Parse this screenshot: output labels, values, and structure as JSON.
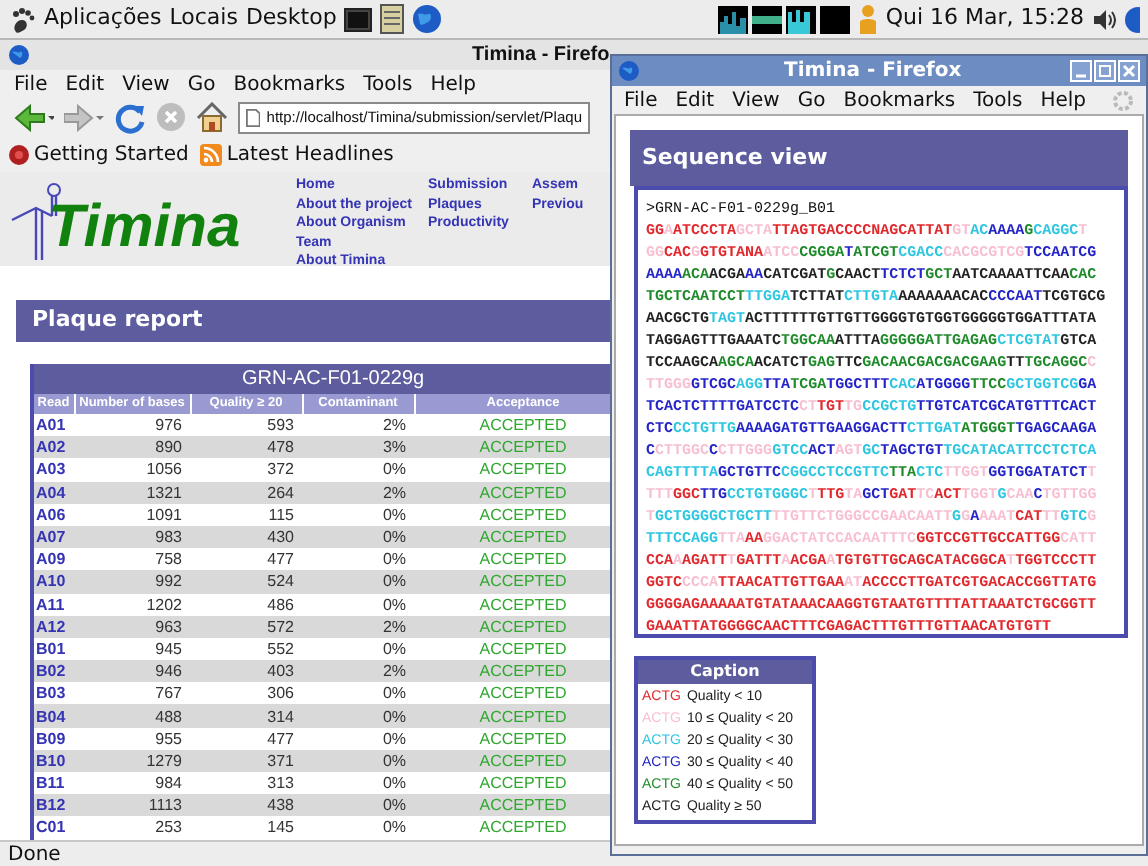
{
  "panel": {
    "menus": [
      "Aplicações",
      "Locais",
      "Desktop"
    ],
    "clock": "Qui 16 Mar, 15:28"
  },
  "back_window": {
    "title": "Timina - Firefo",
    "menu": [
      "File",
      "Edit",
      "View",
      "Go",
      "Bookmarks",
      "Tools",
      "Help"
    ],
    "address": "http://localhost/Timina/submission/servlet/Plaqu",
    "bookmarks": [
      "Getting Started",
      "Latest Headlines"
    ],
    "logo": "Timina",
    "nav_columns": [
      [
        "Home",
        "About the project",
        "About Organism",
        "Team",
        "About Timina"
      ],
      [
        "Submission",
        "Plaques",
        "Productivity"
      ],
      [
        "Assem",
        "Previou"
      ]
    ],
    "section_title": "Plaque report",
    "table": {
      "title": "GRN-AC-F01-0229g",
      "columns": [
        "Read",
        "Number of bases",
        "Quality ≥ 20",
        "Contaminant",
        "Acceptance"
      ],
      "rows": [
        [
          "A01",
          "976",
          "593",
          "2%",
          "ACCEPTED"
        ],
        [
          "A02",
          "890",
          "478",
          "3%",
          "ACCEPTED"
        ],
        [
          "A03",
          "1056",
          "372",
          "0%",
          "ACCEPTED"
        ],
        [
          "A04",
          "1321",
          "264",
          "2%",
          "ACCEPTED"
        ],
        [
          "A06",
          "1091",
          "115",
          "0%",
          "ACCEPTED"
        ],
        [
          "A07",
          "983",
          "430",
          "0%",
          "ACCEPTED"
        ],
        [
          "A09",
          "758",
          "477",
          "0%",
          "ACCEPTED"
        ],
        [
          "A10",
          "992",
          "524",
          "0%",
          "ACCEPTED"
        ],
        [
          "A11",
          "1202",
          "486",
          "0%",
          "ACCEPTED"
        ],
        [
          "A12",
          "963",
          "572",
          "2%",
          "ACCEPTED"
        ],
        [
          "B01",
          "945",
          "552",
          "0%",
          "ACCEPTED"
        ],
        [
          "B02",
          "946",
          "403",
          "2%",
          "ACCEPTED"
        ],
        [
          "B03",
          "767",
          "306",
          "0%",
          "ACCEPTED"
        ],
        [
          "B04",
          "488",
          "314",
          "0%",
          "ACCEPTED"
        ],
        [
          "B09",
          "955",
          "477",
          "0%",
          "ACCEPTED"
        ],
        [
          "B10",
          "1279",
          "371",
          "0%",
          "ACCEPTED"
        ],
        [
          "B11",
          "984",
          "313",
          "0%",
          "ACCEPTED"
        ],
        [
          "B12",
          "1113",
          "438",
          "0%",
          "ACCEPTED"
        ],
        [
          "C01",
          "253",
          "145",
          "0%",
          "ACCEPTED"
        ]
      ]
    },
    "status": "Done"
  },
  "popup": {
    "title": "Timina - Firefox",
    "menu": [
      "File",
      "Edit",
      "View",
      "Go",
      "Bookmarks",
      "Tools",
      "Help"
    ],
    "section_title": "Sequence view",
    "sequence": {
      "header": ">GRN-AC-F01-0229g_B01",
      "lines": [
        [
          {
            "text": "GG",
            "color": "#e0282d"
          },
          {
            "text": "A",
            "color": "#f7bfd0"
          },
          {
            "text": "ATCCCTA",
            "color": "#e0282d"
          },
          {
            "text": "GCTA",
            "color": "#f7bfd0"
          },
          {
            "text": "TTAGTGACCCCNAGCATTAT",
            "color": "#e0282d"
          },
          {
            "text": "GT",
            "color": "#f7bfd0"
          },
          {
            "text": "AC",
            "color": "#2ec6e0"
          },
          {
            "text": "AAAA",
            "color": "#2424c8"
          },
          {
            "text": "G",
            "color": "#1e8a2a"
          },
          {
            "text": "CAGGC",
            "color": "#2ec6e0"
          },
          {
            "text": "T",
            "color": "#f7bfd0"
          }
        ],
        [
          {
            "text": "GG",
            "color": "#f7bfd0"
          },
          {
            "text": "CAC",
            "color": "#e0282d"
          },
          {
            "text": "G",
            "color": "#f7bfd0"
          },
          {
            "text": "GTGTANA",
            "color": "#e0282d"
          },
          {
            "text": "ATCC",
            "color": "#f7bfd0"
          },
          {
            "text": "CGGGA",
            "color": "#1e8a2a"
          },
          {
            "text": "T",
            "color": "#2424c8"
          },
          {
            "text": "ATCGT",
            "color": "#1e8a2a"
          },
          {
            "text": "CGACC",
            "color": "#2ec6e0"
          },
          {
            "text": "CACGCGTCG",
            "color": "#f7bfd0"
          },
          {
            "text": "TCCAATCG",
            "color": "#2424c8"
          }
        ],
        [
          {
            "text": "AAAA",
            "color": "#2424c8"
          },
          {
            "text": "ACA",
            "color": "#1e8a2a"
          },
          {
            "text": "ACGA",
            "color": "#222222"
          },
          {
            "text": "AA",
            "color": "#2424c8"
          },
          {
            "text": "CATCGAT",
            "color": "#222222"
          },
          {
            "text": "G",
            "color": "#1e8a2a"
          },
          {
            "text": "CAACT",
            "color": "#222222"
          },
          {
            "text": "TCTCT",
            "color": "#2424c8"
          },
          {
            "text": "GCT",
            "color": "#1e8a2a"
          },
          {
            "text": "AATCAAAATTCAA",
            "color": "#222222"
          },
          {
            "text": "CAC",
            "color": "#1e8a2a"
          }
        ],
        [
          {
            "text": "TGCTCAATCCT",
            "color": "#1e8a2a"
          },
          {
            "text": "TTGGA",
            "color": "#2ec6e0"
          },
          {
            "text": "TCTTAT",
            "color": "#222222"
          },
          {
            "text": "CTTGTA",
            "color": "#2ec6e0"
          },
          {
            "text": "AAAAAAACAC",
            "color": "#222222"
          },
          {
            "text": "CCCAAT",
            "color": "#2424c8"
          },
          {
            "text": "TCGTGCG",
            "color": "#222222"
          }
        ],
        [
          {
            "text": "AACGCTG",
            "color": "#222222"
          },
          {
            "text": "TAGT",
            "color": "#2ec6e0"
          },
          {
            "text": "ACTTTTTTGTTGTTGGGGTGTGGTGGGGGTGGATTTATA",
            "color": "#222222"
          }
        ],
        [
          {
            "text": "TAGGAGTTTGAAATC",
            "color": "#222222"
          },
          {
            "text": "TGGCAA",
            "color": "#1e8a2a"
          },
          {
            "text": "ATTTA",
            "color": "#222222"
          },
          {
            "text": "GGGGGATTGAGAG",
            "color": "#1e8a2a"
          },
          {
            "text": "CTCGTAT",
            "color": "#2ec6e0"
          },
          {
            "text": "GTCA",
            "color": "#222222"
          }
        ],
        [
          {
            "text": "TCCAAGCA",
            "color": "#222222"
          },
          {
            "text": "AGCA",
            "color": "#1e8a2a"
          },
          {
            "text": "ACATCT",
            "color": "#222222"
          },
          {
            "text": "GAG",
            "color": "#1e8a2a"
          },
          {
            "text": "TTC",
            "color": "#222222"
          },
          {
            "text": "GACAACGACGACGAAG",
            "color": "#1e8a2a"
          },
          {
            "text": "TT",
            "color": "#222222"
          },
          {
            "text": "TGCAGGC",
            "color": "#1e8a2a"
          },
          {
            "text": "C",
            "color": "#f7bfd0"
          }
        ],
        [
          {
            "text": "TTGGG",
            "color": "#f7bfd0"
          },
          {
            "text": "GTCGC",
            "color": "#2424c8"
          },
          {
            "text": "AGG",
            "color": "#2ec6e0"
          },
          {
            "text": "TTA",
            "color": "#2424c8"
          },
          {
            "text": "TCGA",
            "color": "#1e8a2a"
          },
          {
            "text": "TGGCTTT",
            "color": "#2424c8"
          },
          {
            "text": "CAC",
            "color": "#2ec6e0"
          },
          {
            "text": "ATGGGG",
            "color": "#2424c8"
          },
          {
            "text": "TTCC",
            "color": "#1e8a2a"
          },
          {
            "text": "GCTGGTCG",
            "color": "#2ec6e0"
          },
          {
            "text": "GA",
            "color": "#2424c8"
          }
        ],
        [
          {
            "text": "TCACTCTTTTGATCCTC",
            "color": "#2424c8"
          },
          {
            "text": "CT",
            "color": "#f7bfd0"
          },
          {
            "text": "TGT",
            "color": "#e0282d"
          },
          {
            "text": "TG",
            "color": "#f7bfd0"
          },
          {
            "text": "CCGCTG",
            "color": "#2ec6e0"
          },
          {
            "text": "TTGTCATCGCATGTTTCACT",
            "color": "#2424c8"
          }
        ],
        [
          {
            "text": "CTC",
            "color": "#2424c8"
          },
          {
            "text": "CCTGTTG",
            "color": "#2ec6e0"
          },
          {
            "text": "AAAAGATGTTGAAGGACTT",
            "color": "#2424c8"
          },
          {
            "text": "CTTGAT",
            "color": "#2ec6e0"
          },
          {
            "text": "ATGGGT",
            "color": "#1e8a2a"
          },
          {
            "text": "TGAGCAAGA",
            "color": "#2424c8"
          }
        ],
        [
          {
            "text": "C",
            "color": "#2424c8"
          },
          {
            "text": "CTTGGC",
            "color": "#f7bfd0"
          },
          {
            "text": "C",
            "color": "#2424c8"
          },
          {
            "text": "CTTGGG",
            "color": "#f7bfd0"
          },
          {
            "text": "GTCC",
            "color": "#2ec6e0"
          },
          {
            "text": "ACT",
            "color": "#2424c8"
          },
          {
            "text": "AGT",
            "color": "#f7bfd0"
          },
          {
            "text": "GC",
            "color": "#2ec6e0"
          },
          {
            "text": "TAGCTGT",
            "color": "#2424c8"
          },
          {
            "text": "TGCATACATTCCTCTCA",
            "color": "#2ec6e0"
          }
        ],
        [
          {
            "text": "CAGTTTTA",
            "color": "#2ec6e0"
          },
          {
            "text": "GCTGTTC",
            "color": "#2424c8"
          },
          {
            "text": "CGGCCTCCGTTC",
            "color": "#2ec6e0"
          },
          {
            "text": "TTA",
            "color": "#1e8a2a"
          },
          {
            "text": "CTC",
            "color": "#2ec6e0"
          },
          {
            "text": "TTGGT",
            "color": "#f7bfd0"
          },
          {
            "text": "GGTGGATATCT",
            "color": "#2424c8"
          },
          {
            "text": "T",
            "color": "#f7bfd0"
          }
        ],
        [
          {
            "text": "TTT",
            "color": "#f7bfd0"
          },
          {
            "text": "GGC",
            "color": "#e0282d"
          },
          {
            "text": "TTG",
            "color": "#2424c8"
          },
          {
            "text": "CCTGTGGGC",
            "color": "#2ec6e0"
          },
          {
            "text": "T",
            "color": "#f7bfd0"
          },
          {
            "text": "TTG",
            "color": "#e0282d"
          },
          {
            "text": "TA",
            "color": "#f7bfd0"
          },
          {
            "text": "GCT",
            "color": "#2424c8"
          },
          {
            "text": "GAT",
            "color": "#e0282d"
          },
          {
            "text": "TC",
            "color": "#f7bfd0"
          },
          {
            "text": "ACT",
            "color": "#e0282d"
          },
          {
            "text": "TGGT",
            "color": "#f7bfd0"
          },
          {
            "text": "G",
            "color": "#2ec6e0"
          },
          {
            "text": "CAA",
            "color": "#f7bfd0"
          },
          {
            "text": "C",
            "color": "#2424c8"
          },
          {
            "text": "TGTTGG",
            "color": "#f7bfd0"
          }
        ],
        [
          {
            "text": "T",
            "color": "#f7bfd0"
          },
          {
            "text": "GCTGGGGCTGCTT",
            "color": "#2ec6e0"
          },
          {
            "text": "TTGTTCTGGGCCGAACAATT",
            "color": "#f7bfd0"
          },
          {
            "text": "G",
            "color": "#2ec6e0"
          },
          {
            "text": "G",
            "color": "#f7bfd0"
          },
          {
            "text": "A",
            "color": "#2424c8"
          },
          {
            "text": "AAAT",
            "color": "#f7bfd0"
          },
          {
            "text": "CAT",
            "color": "#e0282d"
          },
          {
            "text": "TT",
            "color": "#f7bfd0"
          },
          {
            "text": "GTC",
            "color": "#2ec6e0"
          },
          {
            "text": "G",
            "color": "#f7bfd0"
          }
        ],
        [
          {
            "text": "TTTCCAGG",
            "color": "#2ec6e0"
          },
          {
            "text": "TTA",
            "color": "#f7bfd0"
          },
          {
            "text": "AA",
            "color": "#e0282d"
          },
          {
            "text": "GGACTATCCACAATTTC",
            "color": "#f7bfd0"
          },
          {
            "text": "GGTCCGTTGCCATTGG",
            "color": "#e0282d"
          },
          {
            "text": "CATT",
            "color": "#f7bfd0"
          }
        ],
        [
          {
            "text": "CCA",
            "color": "#e0282d"
          },
          {
            "text": "A",
            "color": "#f7bfd0"
          },
          {
            "text": "AGATT",
            "color": "#e0282d"
          },
          {
            "text": "T",
            "color": "#f7bfd0"
          },
          {
            "text": "GATTT",
            "color": "#e0282d"
          },
          {
            "text": "A",
            "color": "#f7bfd0"
          },
          {
            "text": "ACGA",
            "color": "#e0282d"
          },
          {
            "text": "A",
            "color": "#f7bfd0"
          },
          {
            "text": "TGTGTTGCAGCATACGGCA",
            "color": "#e0282d"
          },
          {
            "text": "T",
            "color": "#f7bfd0"
          },
          {
            "text": "TGGTCCCTT",
            "color": "#e0282d"
          }
        ],
        [
          {
            "text": "GGTC",
            "color": "#e0282d"
          },
          {
            "text": "CCCA",
            "color": "#f7bfd0"
          },
          {
            "text": "TTAACATTGTTGAA",
            "color": "#e0282d"
          },
          {
            "text": "AT",
            "color": "#f7bfd0"
          },
          {
            "text": "ACCCCTTGATCGTGACACCGGTTATG",
            "color": "#e0282d"
          }
        ],
        [
          {
            "text": "GGGGAGAAAAATGTATAAACAAGGTGTAATGTTTTATTAAATCTGCGGTT",
            "color": "#e0282d"
          }
        ],
        [
          {
            "text": "GAAATTATGGGGCAACTTTCGAGACTTTGTTTGTTAACATGTGTT",
            "color": "#e0282d"
          }
        ]
      ]
    },
    "caption": {
      "title": "Caption",
      "items": [
        {
          "sample": "ACTG",
          "label": "Quality < 10",
          "color": "#e0282d"
        },
        {
          "sample": "ACTG",
          "label": "10 ≤ Quality < 20",
          "color": "#f7bfd0"
        },
        {
          "sample": "ACTG",
          "label": "20 ≤ Quality < 30",
          "color": "#2ec6e0"
        },
        {
          "sample": "ACTG",
          "label": "30 ≤ Quality < 40",
          "color": "#2424c8"
        },
        {
          "sample": "ACTG",
          "label": "40 ≤ Quality < 50",
          "color": "#1e8a2a"
        },
        {
          "sample": "ACTG",
          "label": "Quality ≥ 50",
          "color": "#222222"
        }
      ]
    }
  }
}
